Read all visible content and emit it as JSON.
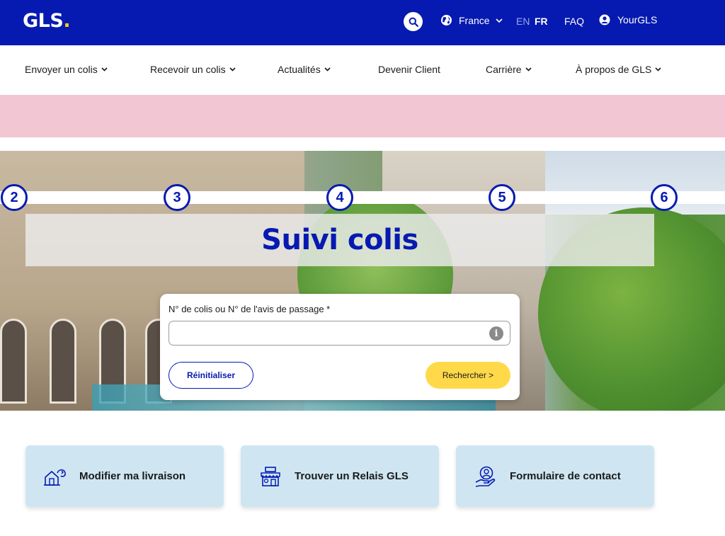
{
  "header": {
    "logo_text": "GLS",
    "logo_dot": ".",
    "country": "France",
    "lang_en": "EN",
    "lang_fr": "FR",
    "faq": "FAQ",
    "account": "YourGLS"
  },
  "nav": {
    "items": [
      {
        "label": "Envoyer un colis"
      },
      {
        "label": "Recevoir un colis"
      },
      {
        "label": "Actualités"
      },
      {
        "label": "Devenir Client"
      },
      {
        "label": "Carrière"
      },
      {
        "label": "À propos de GLS"
      }
    ]
  },
  "hero": {
    "title": "Suivi colis",
    "steps": [
      "2",
      "3",
      "4",
      "5",
      "6"
    ]
  },
  "tracking": {
    "label": "N° de colis ou N° de l'avis de passage *",
    "value": "",
    "info_glyph": "i",
    "reset_label": "Réinitialiser",
    "search_label": "Rechercher >"
  },
  "tiles": [
    {
      "label": "Modifier ma livraison",
      "icon": "home-delivery-icon"
    },
    {
      "label": "Trouver un Relais GLS",
      "icon": "store-icon"
    },
    {
      "label": "Formulaire de contact",
      "icon": "contact-hand-icon"
    }
  ],
  "colors": {
    "brand_blue": "#061ab1",
    "accent_yellow": "#ffd100",
    "banner_pink": "#f2c6d2",
    "tile_blue": "#cfe6f2"
  }
}
